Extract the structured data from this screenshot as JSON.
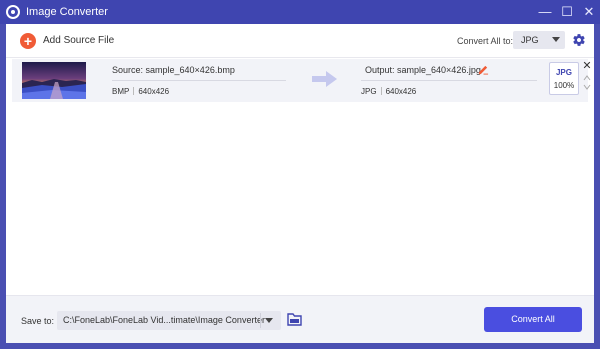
{
  "window": {
    "title": "Image Converter"
  },
  "toolbar": {
    "add_source_label": "Add Source File",
    "convert_all_to_label": "Convert All to:",
    "convert_all_format": "JPG"
  },
  "files": [
    {
      "source_name": "Source: sample_640×426.bmp",
      "source_format": "BMP",
      "source_size": "640x426",
      "output_name": "Output: sample_640×426.jpg",
      "output_format": "JPG",
      "output_size": "640x426",
      "format_badge": "JPG",
      "quality": "100%"
    }
  ],
  "footer": {
    "save_to_label": "Save to:",
    "save_path": "C:\\FoneLab\\FoneLab Vid...timate\\Image Converter",
    "convert_all_button": "Convert All"
  },
  "colors": {
    "window_frame": "#4a4fb2",
    "accent": "#4a4ee0",
    "add_button": "#f05b36",
    "row_background": "#f2f3f8"
  },
  "icons": [
    "app-logo-icon",
    "minimize-icon",
    "maximize-icon",
    "close-icon",
    "add-icon",
    "gear-icon",
    "arrow-right-icon",
    "edit-icon",
    "chevron-up-icon",
    "chevron-down-icon",
    "folder-icon"
  ]
}
